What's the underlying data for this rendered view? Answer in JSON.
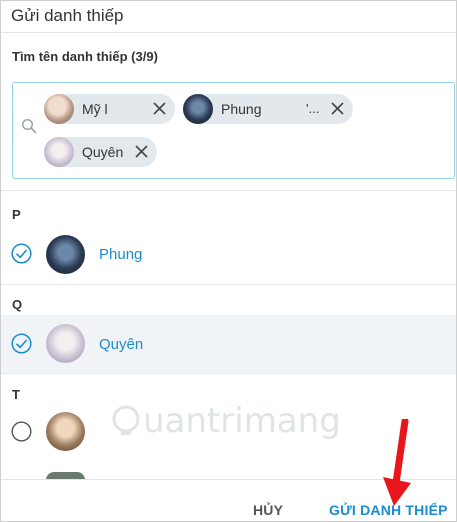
{
  "dialog": {
    "title": "Gửi danh thiếp",
    "field_label": "Tìm tên danh thiếp (3/9)"
  },
  "selected_chips": [
    {
      "name": "Mỹ l"
    },
    {
      "name": "Phung",
      "trail": "'..."
    },
    {
      "name": "Quyên"
    }
  ],
  "sections": [
    {
      "letter": "P",
      "contact": {
        "name": "Phung",
        "checked": true
      }
    },
    {
      "letter": "Q",
      "contact": {
        "name": "Quyên",
        "checked": true
      }
    },
    {
      "letter": "T",
      "contact": {
        "name": "",
        "checked": false
      }
    }
  ],
  "footer": {
    "cancel_label": "HỦY",
    "send_label": "GỬI DANH THIẾP"
  },
  "watermark": {
    "text": "uantrimang"
  },
  "colors": {
    "accent": "#1a8ccc",
    "chip_bg": "#e3e8ec",
    "selected_row_bg": "#f0f4f7",
    "annotation_arrow": "#e8161b"
  }
}
